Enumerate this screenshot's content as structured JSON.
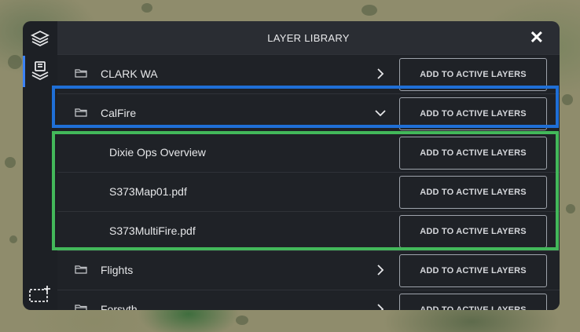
{
  "header": {
    "title": "LAYER LIBRARY",
    "close_label": "✕"
  },
  "rail": {
    "items": [
      {
        "icon": "layers-icon"
      },
      {
        "icon": "layer-library-icon"
      }
    ],
    "bottom_icon": "add-area-icon"
  },
  "rows": [
    {
      "label": "CLARK WA",
      "type": "folder",
      "expanded": false,
      "button": "ADD TO ACTIVE LAYERS"
    },
    {
      "label": "CalFire",
      "type": "folder",
      "expanded": true,
      "button": "ADD TO ACTIVE LAYERS"
    },
    {
      "label": "Dixie Ops Overview",
      "type": "file",
      "button": "ADD TO ACTIVE LAYERS"
    },
    {
      "label": "S373Map01.pdf",
      "type": "file",
      "button": "ADD TO ACTIVE LAYERS"
    },
    {
      "label": "S373MultiFire.pdf",
      "type": "file",
      "button": "ADD TO ACTIVE LAYERS"
    },
    {
      "label": "Flights",
      "type": "folder",
      "expanded": false,
      "button": "ADD TO ACTIVE LAYERS"
    },
    {
      "label": "Forsyth",
      "type": "folder",
      "expanded": false,
      "button": "ADD TO ACTIVE LAYERS"
    }
  ],
  "colors": {
    "highlight_blue": "#1f6fd6",
    "highlight_green": "#43b85a",
    "rail_active": "#3b82f6"
  }
}
